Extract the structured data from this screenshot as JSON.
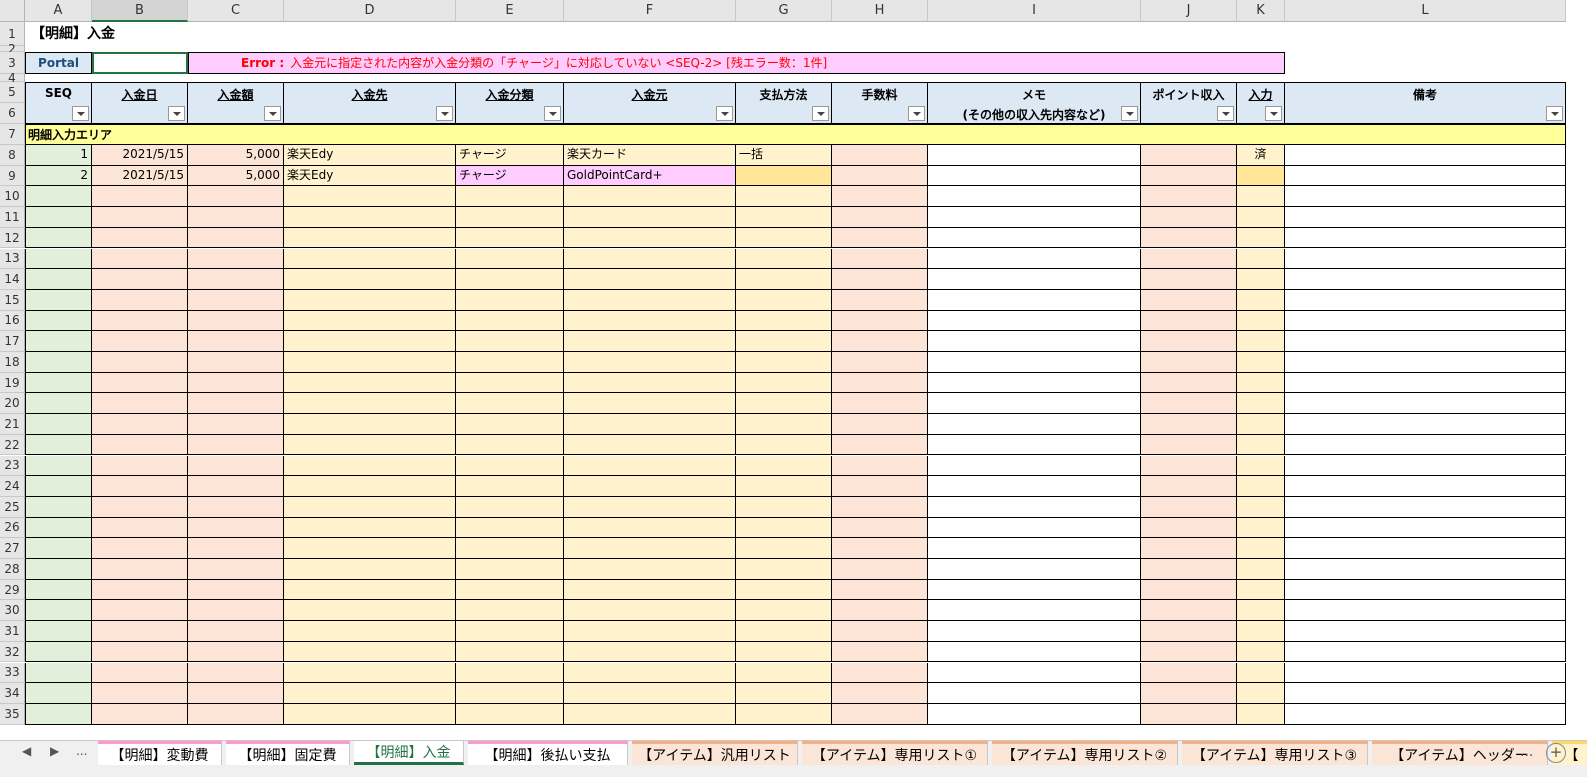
{
  "columns": [
    "A",
    "B",
    "C",
    "D",
    "E",
    "F",
    "G",
    "H",
    "I",
    "J",
    "K",
    "L"
  ],
  "rows": [
    "1",
    "2",
    "3",
    "4",
    "5",
    "6",
    "7",
    "8",
    "9",
    "10",
    "11",
    "12",
    "13",
    "14",
    "15",
    "16",
    "17",
    "18",
    "19",
    "20",
    "21",
    "22",
    "23",
    "24",
    "25",
    "26",
    "27",
    "28",
    "29",
    "30",
    "31",
    "32",
    "33",
    "34",
    "35"
  ],
  "title": "【明細】入金",
  "portal_label": "Portal",
  "error": {
    "prefix": "Error :",
    "message": "入金元に指定された内容が入金分類の「チャージ」に対応していない <SEQ-2> [残エラー数：1件]"
  },
  "headers": {
    "seq": "SEQ",
    "date": "入金日",
    "amount": "入金額",
    "dest": "入金先",
    "category": "入金分類",
    "source": "入金元",
    "method": "支払方法",
    "fee": "手数料",
    "memo1": "メモ",
    "memo2": "(その他の収入先内容など)",
    "points": "ポイント収入",
    "input": "入力",
    "notes": "備考"
  },
  "area_label": "明細入力エリア",
  "records": [
    {
      "seq": "1",
      "date": "2021/5/15",
      "amount": "5,000",
      "dest": "楽天Edy",
      "category": "チャージ",
      "source": "楽天カード",
      "method": "一括",
      "fee": "",
      "memo": "",
      "points": "",
      "input": "済",
      "notes": ""
    },
    {
      "seq": "2",
      "date": "2021/5/15",
      "amount": "5,000",
      "dest": "楽天Edy",
      "category": "チャージ",
      "source": "GoldPointCard+",
      "method": "",
      "fee": "",
      "memo": "",
      "points": "",
      "input": "",
      "notes": ""
    }
  ],
  "sheet_tabs": [
    "【明細】変動費",
    "【明細】固定費",
    "【明細】入金",
    "【明細】後払い支払",
    "【アイテム】汎用リスト",
    "【アイテム】専用リスト①",
    "【アイテム】専用リスト②",
    "【アイテム】専用リスト③",
    "【アイテム】ヘッダー",
    "【"
  ],
  "nav": {
    "prev": "◀",
    "next": "▶",
    "more": "...",
    "more_right": "...",
    "add": "+"
  },
  "colors": {
    "header_bg": "#dce9f5",
    "seq_bg": "#e2efda",
    "pink_bg": "#fce4d6",
    "yellow_bg": "#fff2cc",
    "error_bg": "#ffccff",
    "error_text": "#ff0000",
    "area_bg": "#ffff99",
    "active_tab_text": "#217346"
  }
}
